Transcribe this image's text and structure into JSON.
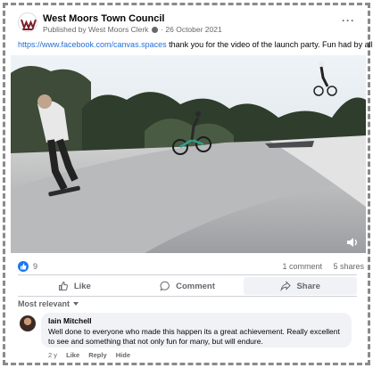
{
  "page": {
    "name": "West Moors Town Council",
    "published_by": "Published by West Moors Clerk",
    "date": "26 October 2021",
    "more": "···",
    "caption_link": "https://www.facebook.com/canvas.spaces",
    "caption_text": " thank you for the video of the launch party. Fun had by all.",
    "colors": {
      "brand_blue": "#1877f2",
      "link": "#216fdb",
      "muted": "#65676b"
    }
  },
  "stats": {
    "likes": "9",
    "comments": "1 comment",
    "shares": "5 shares"
  },
  "actions": {
    "like": "Like",
    "comment": "Comment",
    "share": "Share"
  },
  "filter": {
    "label": "Most relevant"
  },
  "comment": {
    "author": "Iain Mitchell",
    "text": "Well done to everyone who made this happen its a great achievement. Really excellent to see and something that not only fun for many, but will endure.",
    "age": "2 y",
    "like": "Like",
    "reply": "Reply",
    "hide": "Hide"
  },
  "icons": {
    "logo": "council-crest-icon",
    "gear": "gear-icon",
    "volume": "volume-icon",
    "like": "thumbs-up-icon",
    "comment": "comment-bubble-icon",
    "share": "share-arrow-icon"
  }
}
